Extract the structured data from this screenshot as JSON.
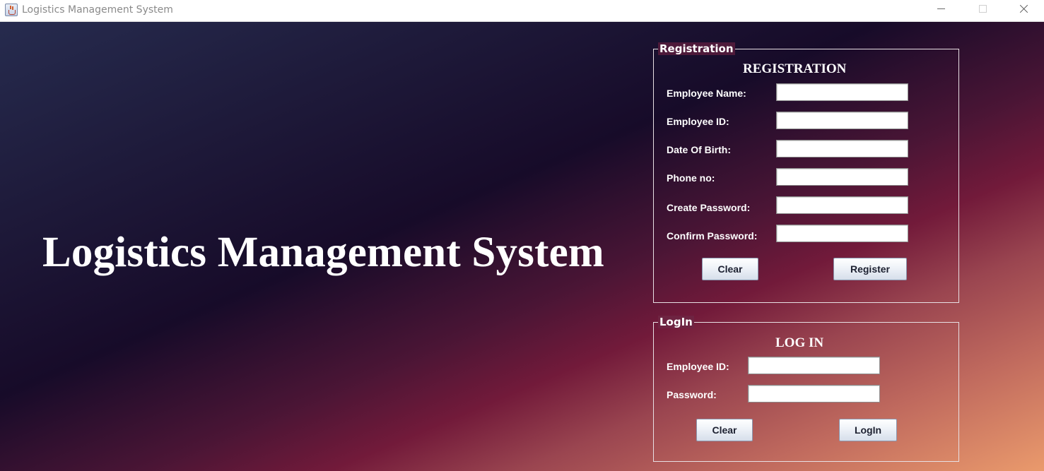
{
  "window": {
    "title": "Logistics Management System"
  },
  "main": {
    "title": "Logistics Management System"
  },
  "registration": {
    "legend": "Registration",
    "heading": "REGISTRATION",
    "fields": [
      {
        "label": "Employee Name:",
        "value": ""
      },
      {
        "label": "Employee ID:",
        "value": ""
      },
      {
        "label": "Date Of Birth:",
        "value": ""
      },
      {
        "label": "Phone no:",
        "value": ""
      },
      {
        "label": "Create Password:",
        "value": ""
      },
      {
        "label": "Confirm Password:",
        "value": ""
      }
    ],
    "clear_label": "Clear",
    "register_label": "Register"
  },
  "login": {
    "legend": "LogIn",
    "heading": "LOG IN",
    "fields": [
      {
        "label": "Employee ID:",
        "value": ""
      },
      {
        "label": "Password:",
        "value": ""
      }
    ],
    "clear_label": "Clear",
    "login_label": "LogIn"
  },
  "colors": {
    "gradient_start": "#262b4e",
    "gradient_dark": "#170b29",
    "gradient_mid": "#721a3a",
    "gradient_end": "#ea9a6c",
    "text": "#ffffff"
  }
}
